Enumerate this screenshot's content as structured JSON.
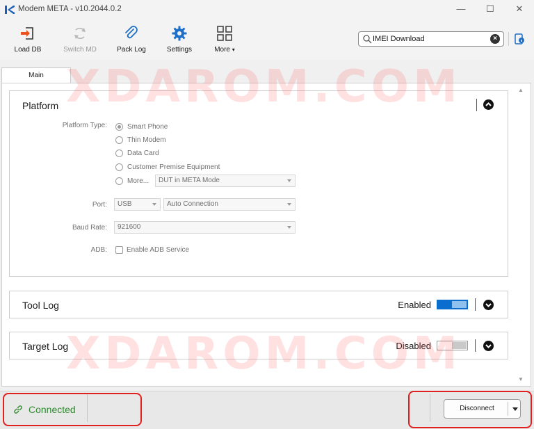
{
  "window": {
    "title": "Modem META - v10.2044.0.2",
    "controls": {
      "minimize": "—",
      "maximize": "☐",
      "close": "✕"
    }
  },
  "toolbar": {
    "buttons": [
      {
        "label": "Load DB",
        "icon": "load-db-icon",
        "enabled": true
      },
      {
        "label": "Switch MD",
        "icon": "switch-md-icon",
        "enabled": false
      },
      {
        "label": "Pack Log",
        "icon": "paperclip-icon",
        "enabled": true
      },
      {
        "label": "Settings",
        "icon": "gear-icon",
        "enabled": true
      },
      {
        "label": "More",
        "icon": "grid-icon",
        "enabled": true
      }
    ],
    "search": {
      "value": "IMEI Download",
      "placeholder": ""
    }
  },
  "tabs": [
    {
      "label": "Main",
      "active": true
    }
  ],
  "watermark": "XDAROM.COM",
  "platform": {
    "title": "Platform",
    "platform_type_label": "Platform Type:",
    "platform_options": [
      {
        "label": "Smart Phone",
        "checked": true
      },
      {
        "label": "Thin Modem",
        "checked": false
      },
      {
        "label": "Data Card",
        "checked": false
      },
      {
        "label": "Customer Premise Equipment",
        "checked": false
      },
      {
        "label": "More...",
        "checked": false
      }
    ],
    "more_select_value": "DUT in META Mode",
    "port_label": "Port:",
    "port_value": "USB",
    "connection_value": "Auto Connection",
    "baud_label": "Baud Rate:",
    "baud_value": "921600",
    "adb_label": "ADB:",
    "adb_option": "Enable ADB Service",
    "adb_checked": false
  },
  "tool_log": {
    "title": "Tool Log",
    "state": "Enabled",
    "on": true
  },
  "target_log": {
    "title": "Target Log",
    "state": "Disabled",
    "on": false
  },
  "status": {
    "connection": "Connected",
    "disconnect_label": "Disconnect",
    "connected_color": "#2e8b2e",
    "highlight_color": "#e12020"
  }
}
